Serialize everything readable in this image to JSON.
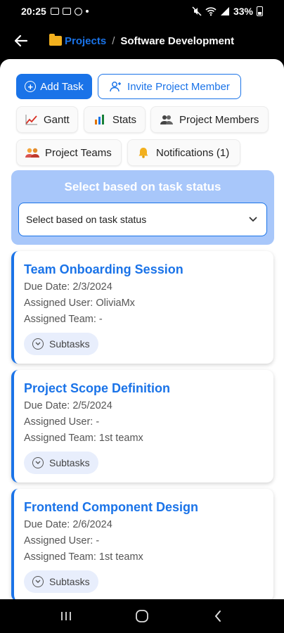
{
  "status_bar": {
    "time": "20:25",
    "battery": "33%"
  },
  "header": {
    "breadcrumb_parent": "Projects",
    "breadcrumb_separator": "/",
    "breadcrumb_current": "Software Development"
  },
  "actions": {
    "add_task": "Add Task",
    "invite_member": "Invite Project Member"
  },
  "chips": {
    "gantt": "Gantt",
    "stats": "Stats",
    "project_members": "Project Members",
    "project_teams": "Project Teams",
    "notifications": "Notifications (1)"
  },
  "filter": {
    "title": "Select based on task status",
    "selected": "Select based on task status"
  },
  "tasks": [
    {
      "title": "Team Onboarding Session",
      "due": "Due Date: 2/3/2024",
      "user": "Assigned User: OliviaMx",
      "team": "Assigned Team: -",
      "subtasks": "Subtasks"
    },
    {
      "title": "Project Scope Definition",
      "due": "Due Date: 2/5/2024",
      "user": "Assigned User: -",
      "team": "Assigned Team: 1st teamx",
      "subtasks": "Subtasks"
    },
    {
      "title": "Frontend Component Design",
      "due": "Due Date: 2/6/2024",
      "user": "Assigned User: -",
      "team": "Assigned Team: 1st teamx",
      "subtasks": "Subtasks"
    }
  ],
  "colors": {
    "accent": "#1a73e8",
    "filter_panel": "#a8c7fa",
    "subtask_chip": "#e8eefc"
  }
}
